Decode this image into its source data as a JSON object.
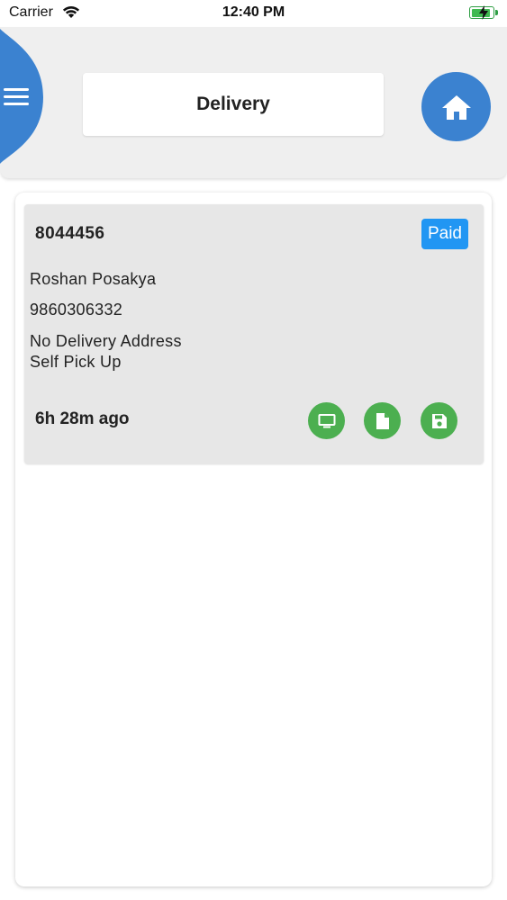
{
  "status_bar": {
    "carrier": "Carrier",
    "time": "12:40 PM"
  },
  "header": {
    "title": "Delivery",
    "menu_icon": "hamburger-menu-icon",
    "home_icon": "home-icon",
    "accent_color": "#3b82d0"
  },
  "order": {
    "id": "8044456",
    "payment_status": "Paid",
    "customer_name": "Roshan Posakya",
    "phone": "9860306332",
    "address_line1": "No Delivery Address",
    "address_line2": "Self Pick Up",
    "time_ago": "6h 28m ago",
    "badge_color": "#2196f3",
    "action_color": "#4caf50",
    "actions": [
      "monitor-icon",
      "document-icon",
      "save-icon"
    ]
  }
}
